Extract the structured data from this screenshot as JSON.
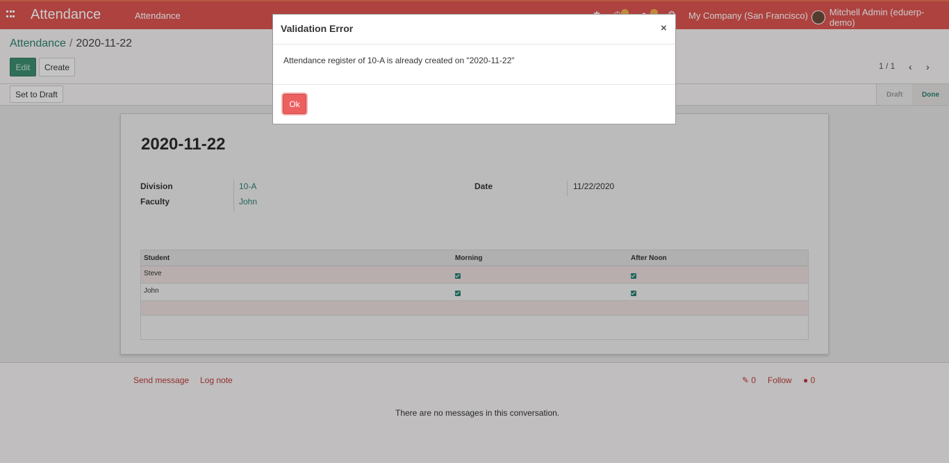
{
  "navbar": {
    "brand": "Attendance",
    "menu_item": "Attendance",
    "company": "My Company (San Francisco)",
    "user": "Mitchell Admin (eduerp-demo)"
  },
  "breadcrumb": {
    "parent": "Attendance",
    "separator": "/",
    "current": "2020-11-22"
  },
  "toolbar": {
    "edit_label": "Edit",
    "create_label": "Create",
    "pager": "1 / 1"
  },
  "statusbar": {
    "set_draft_label": "Set to Draft",
    "stages": [
      "Draft",
      "Done"
    ]
  },
  "record": {
    "title": "2020-11-22",
    "division_label": "Division",
    "division_value": "10-A",
    "faculty_label": "Faculty",
    "faculty_value": "John",
    "date_label": "Date",
    "date_value": "11/22/2020"
  },
  "lines": {
    "columns": [
      "Student",
      "Morning",
      "After Noon"
    ],
    "rows": [
      {
        "student": "Steve",
        "morning": true,
        "afternoon": true
      },
      {
        "student": "John",
        "morning": true,
        "afternoon": true
      }
    ]
  },
  "chatter": {
    "send_message": "Send message",
    "log_note": "Log note",
    "attachments": "0",
    "follow": "Follow",
    "followers": "0",
    "empty": "There are no messages in this conversation."
  },
  "modal": {
    "title": "Validation Error",
    "close": "×",
    "message": "Attendance register of 10-A is already created on \"2020-11-22\"",
    "ok_label": "Ok"
  },
  "colors": {
    "navbar": "#d9534f",
    "primary": "#3d8b6d",
    "link": "#2a7e6f",
    "danger": "#ec6060"
  }
}
